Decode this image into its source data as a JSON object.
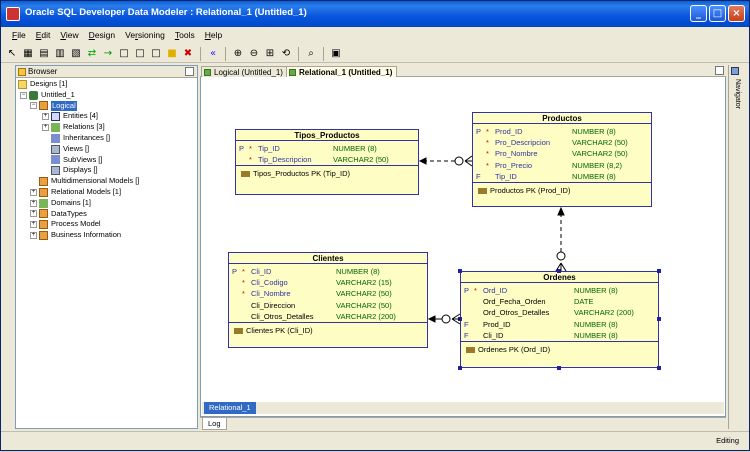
{
  "window": {
    "title": "Oracle SQL Developer Data Modeler : Relational_1 (Untitled_1)"
  },
  "menu": [
    {
      "pre": "",
      "key": "F",
      "post": "ile"
    },
    {
      "pre": "",
      "key": "E",
      "post": "dit"
    },
    {
      "pre": "",
      "key": "V",
      "post": "iew"
    },
    {
      "pre": "",
      "key": "D",
      "post": "esign"
    },
    {
      "pre": "Ve",
      "key": "r",
      "post": "sioning"
    },
    {
      "pre": "",
      "key": "T",
      "post": "ools"
    },
    {
      "pre": "",
      "key": "H",
      "post": "elp"
    }
  ],
  "browser": {
    "tab_label": "Browser",
    "tree": {
      "designs": "Designs [1]",
      "untitled": "Untitled_1",
      "logical": "Logical",
      "entities": "Entities [4]",
      "relations": "Relations [3]",
      "inheritances": "Inheritances []",
      "views": "Views []",
      "subviews": "SubViews []",
      "displays": "Displays []",
      "multidimensional": "Multidimensional Models []",
      "relational": "Relational Models [1]",
      "domains": "Domains [1]",
      "datatypes": "DataTypes",
      "process": "Process Model",
      "business": "Business Information"
    }
  },
  "editor_tabs": {
    "logical": "Logical (Untitled_1)",
    "relational": "Relational_1 (Untitled_1)"
  },
  "navigator_label": "Navigator",
  "entities": {
    "tipos": {
      "name": "Tipos_Productos",
      "attrs": [
        {
          "flag": "P",
          "star": "*",
          "name": "Tip_ID",
          "type": "NUMBER (8)"
        },
        {
          "flag": "",
          "star": "*",
          "name": "Tip_Descripcion",
          "type": "VARCHAR2 (50)"
        }
      ],
      "key": "Tipos_Productos PK (Tip_ID)"
    },
    "productos": {
      "name": "Productos",
      "attrs": [
        {
          "flag": "P",
          "star": "*",
          "name": "Prod_ID",
          "type": "NUMBER (8)"
        },
        {
          "flag": "",
          "star": "*",
          "name": "Pro_Descripcion",
          "type": "VARCHAR2 (50)"
        },
        {
          "flag": "",
          "star": "*",
          "name": "Pro_Nombre",
          "type": "VARCHAR2 (50)"
        },
        {
          "flag": "",
          "star": "*",
          "name": "Pro_Precio",
          "type": "NUMBER (8,2)"
        },
        {
          "flag": "F",
          "star": "",
          "name": "Tip_ID",
          "type": "NUMBER (8)"
        }
      ],
      "key": "Productos PK (Prod_ID)"
    },
    "clientes": {
      "name": "Clientes",
      "attrs": [
        {
          "flag": "P",
          "star": "*",
          "name": "Cli_ID",
          "type": "NUMBER (8)"
        },
        {
          "flag": "",
          "star": "*",
          "name": "Cli_Codigo",
          "type": "VARCHAR2 (15)"
        },
        {
          "flag": "",
          "star": "*",
          "name": "Cli_Nombre",
          "type": "VARCHAR2 (50)"
        },
        {
          "flag": "",
          "star": "",
          "name": "Cli_Direccion",
          "type": "VARCHAR2 (50)"
        },
        {
          "flag": "",
          "star": "",
          "name": "Cli_Otros_Detalles",
          "type": "VARCHAR2 (200)"
        }
      ],
      "key": "Clientes PK (Cli_ID)"
    },
    "ordenes": {
      "name": "Ordenes",
      "attrs": [
        {
          "flag": "P",
          "star": "*",
          "name": "Ord_ID",
          "type": "NUMBER (8)"
        },
        {
          "flag": "",
          "star": "",
          "name": "Ord_Fecha_Orden",
          "type": "DATE"
        },
        {
          "flag": "",
          "star": "",
          "name": "Ord_Otros_Detalles",
          "type": "VARCHAR2 (200)"
        },
        {
          "flag": "F",
          "star": "",
          "name": "Prod_ID",
          "type": "NUMBER (8)"
        },
        {
          "flag": "F",
          "star": "",
          "name": "Cli_ID",
          "type": "NUMBER (8)"
        }
      ],
      "key": "Ordenes PK (Ord_ID)"
    }
  },
  "bottom_tab": "Relational_1",
  "log_tab": "Log",
  "status": "Editing"
}
